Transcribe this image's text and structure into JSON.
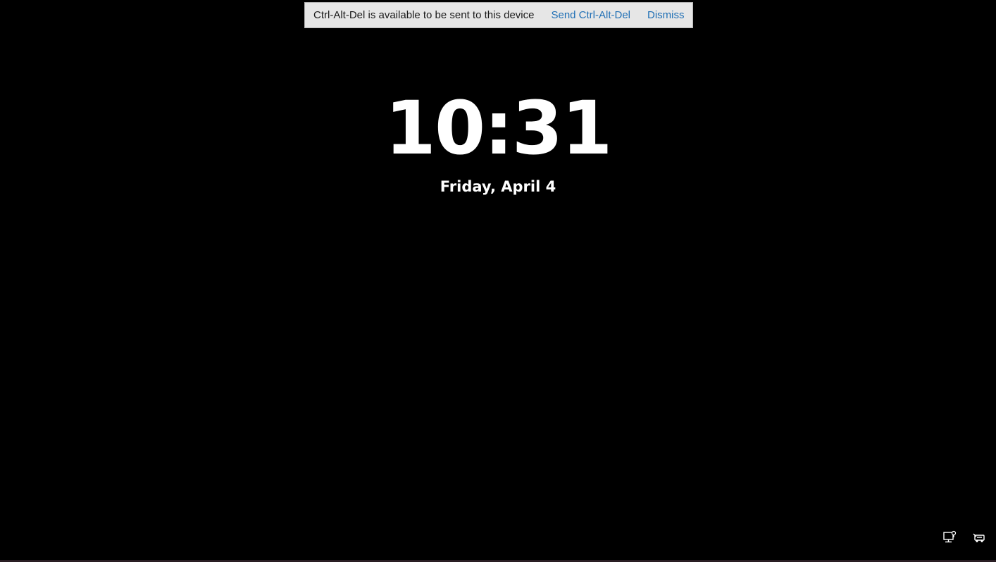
{
  "notification": {
    "message": "Ctrl-Alt-Del is available to be sent to this device",
    "send_label": "Send Ctrl-Alt-Del",
    "dismiss_label": "Dismiss"
  },
  "lock_screen": {
    "time": "10:31",
    "date": "Friday, April 4"
  },
  "tray": {
    "icons": [
      "network-icon",
      "ease-of-access-icon"
    ]
  },
  "colors": {
    "background": "#000000",
    "notice_bar": "#e6e6e6",
    "link": "#1f6fb5",
    "text": "#ffffff"
  }
}
